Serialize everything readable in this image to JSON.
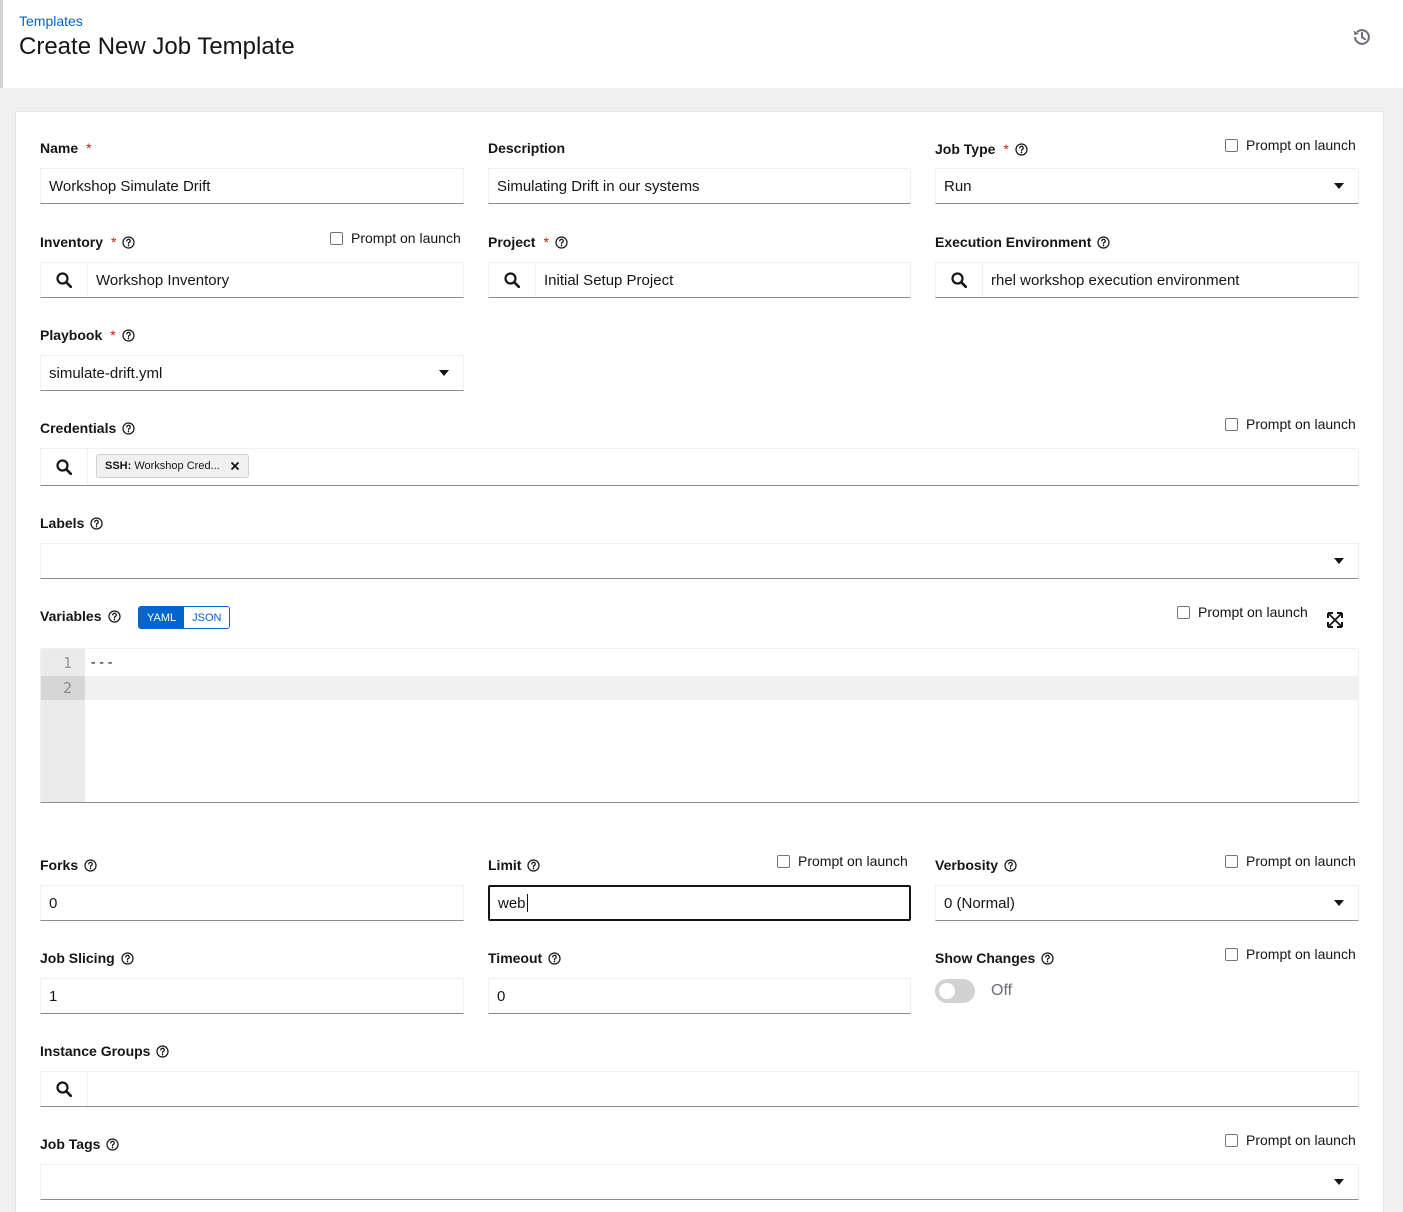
{
  "header": {
    "breadcrumb": "Templates",
    "title": "Create New Job Template"
  },
  "form": {
    "prompt_label": "Prompt on launch",
    "name": {
      "label": "Name",
      "value": "Workshop Simulate Drift"
    },
    "description": {
      "label": "Description",
      "value": "Simulating Drift in our systems"
    },
    "job_type": {
      "label": "Job Type",
      "value": "Run"
    },
    "inventory": {
      "label": "Inventory",
      "value": "Workshop Inventory"
    },
    "project": {
      "label": "Project",
      "value": "Initial Setup Project"
    },
    "execution_environment": {
      "label": "Execution Environment",
      "value": "rhel workshop execution environment"
    },
    "playbook": {
      "label": "Playbook",
      "value": "simulate-drift.yml"
    },
    "credentials": {
      "label": "Credentials",
      "chip_type": "SSH:",
      "chip_name": "Workshop Cred..."
    },
    "labels": {
      "label": "Labels",
      "value": ""
    },
    "variables": {
      "label": "Variables",
      "formats": [
        "YAML",
        "JSON"
      ],
      "active_format": "YAML",
      "lines": [
        {
          "num": "1",
          "code": "---"
        },
        {
          "num": "2",
          "code": ""
        }
      ]
    },
    "forks": {
      "label": "Forks",
      "value": "0"
    },
    "limit": {
      "label": "Limit",
      "value": "web"
    },
    "verbosity": {
      "label": "Verbosity",
      "value": "0 (Normal)"
    },
    "job_slicing": {
      "label": "Job Slicing",
      "value": "1"
    },
    "timeout": {
      "label": "Timeout",
      "value": "0"
    },
    "show_changes": {
      "label": "Show Changes",
      "state": "Off"
    },
    "instance_groups": {
      "label": "Instance Groups",
      "value": ""
    },
    "job_tags": {
      "label": "Job Tags",
      "value": ""
    }
  },
  "colors": {
    "link": "#0066cc",
    "required": "#c9190b",
    "border": "#8a8d90"
  }
}
